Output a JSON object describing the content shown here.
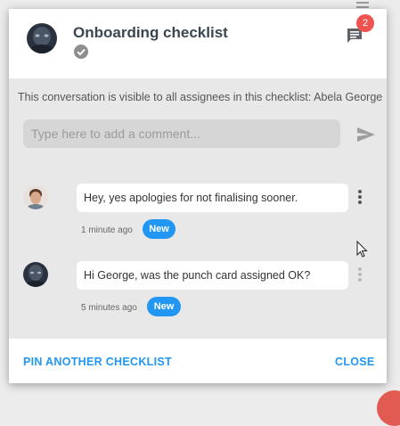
{
  "header": {
    "title": "Onboarding checklist",
    "notification_count": "2"
  },
  "visibility_note": "This conversation is visible to all assignees in this checklist: Abela George",
  "comment": {
    "placeholder": "Type here to add a comment..."
  },
  "messages": [
    {
      "author_avatar": "avatar-george",
      "text": "Hey, yes apologies for not finalising sooner.",
      "time": "1 minute ago",
      "badge": "New"
    },
    {
      "author_avatar": "avatar-dark",
      "text": "Hi George, was the punch card assigned OK?",
      "time": "5 minutes ago",
      "badge": "New"
    }
  ],
  "footer": {
    "pin_label": "PIN ANOTHER CHECKLIST",
    "close_label": "CLOSE"
  },
  "colors": {
    "accent": "#2196f3",
    "badge": "#ef5350",
    "title": "#3a4650"
  }
}
